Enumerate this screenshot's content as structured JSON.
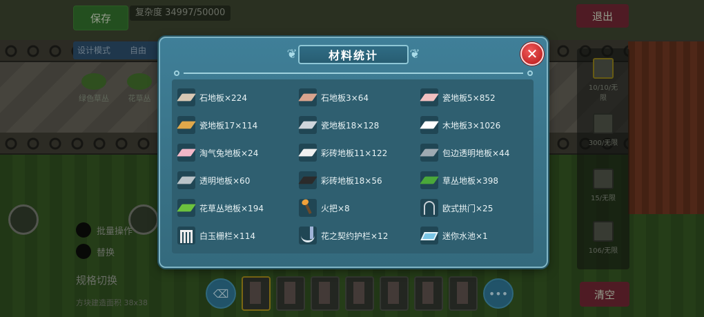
{
  "header": {
    "save_label": "保存",
    "complexity_text": "复杂度 34997/50000",
    "exit_label": "退出"
  },
  "tags": [
    "设计模式",
    "自由"
  ],
  "left_items": [
    "绿色草丛",
    "花草丛"
  ],
  "right_panel": {
    "slots": [
      "10/10/无限",
      "300/无限",
      "15/无限",
      "106/无限"
    ]
  },
  "options": [
    "批量操作",
    "替换"
  ],
  "switch": {
    "label": "规格切换",
    "sub": "方块建造面积 38x38"
  },
  "clear_label": "清空",
  "modal": {
    "title": "材料统计",
    "close_label": "✕",
    "items": [
      {
        "label": "石地板×224",
        "icon": "stone-floor-icon",
        "color": "#d8c8b4"
      },
      {
        "label": "石地板3×64",
        "icon": "stone-floor-icon",
        "color": "#d9a48e"
      },
      {
        "label": "瓷地板5×852",
        "icon": "ceramic-floor-icon",
        "color": "#f2c0c0"
      },
      {
        "label": "瓷地板17×114",
        "icon": "ceramic-floor-icon",
        "color": "#e0a84a"
      },
      {
        "label": "瓷地板18×128",
        "icon": "ceramic-floor-icon",
        "color": "#cfd6dc"
      },
      {
        "label": "木地板3×1026",
        "icon": "wood-floor-icon",
        "color": "#ffffff"
      },
      {
        "label": "淘气兔地板×24",
        "icon": "rabbit-floor-icon",
        "color": "#f3b8c8"
      },
      {
        "label": "彩砖地板11×122",
        "icon": "tile-floor-icon",
        "color": "#f0f0f0"
      },
      {
        "label": "包边透明地板×44",
        "icon": "glass-floor-icon",
        "color": "#9eaab2"
      },
      {
        "label": "透明地板×60",
        "icon": "glass-floor-icon",
        "color": "#b9c3c8"
      },
      {
        "label": "彩砖地板18×56",
        "icon": "tile-floor-icon",
        "color": "#2b2b2b"
      },
      {
        "label": "草丛地板×398",
        "icon": "grass-floor-icon",
        "color": "#4aa83a"
      },
      {
        "label": "花草丛地板×194",
        "icon": "flower-grass-floor-icon",
        "color": "#6cc23e"
      },
      {
        "label": "火把×8",
        "icon": "torch-icon",
        "color": "#f2a23a"
      },
      {
        "label": "欧式拱门×25",
        "icon": "arch-door-icon",
        "color": "#c9d1d6"
      },
      {
        "label": "白玉栅栏×114",
        "icon": "fence-icon",
        "color": "#f2f2f2"
      },
      {
        "label": "花之契约护栏×12",
        "icon": "flower-rail-icon",
        "color": "#dfe9ef"
      },
      {
        "label": "迷你水池×1",
        "icon": "pool-icon",
        "color": "#7bc6e6"
      }
    ]
  }
}
